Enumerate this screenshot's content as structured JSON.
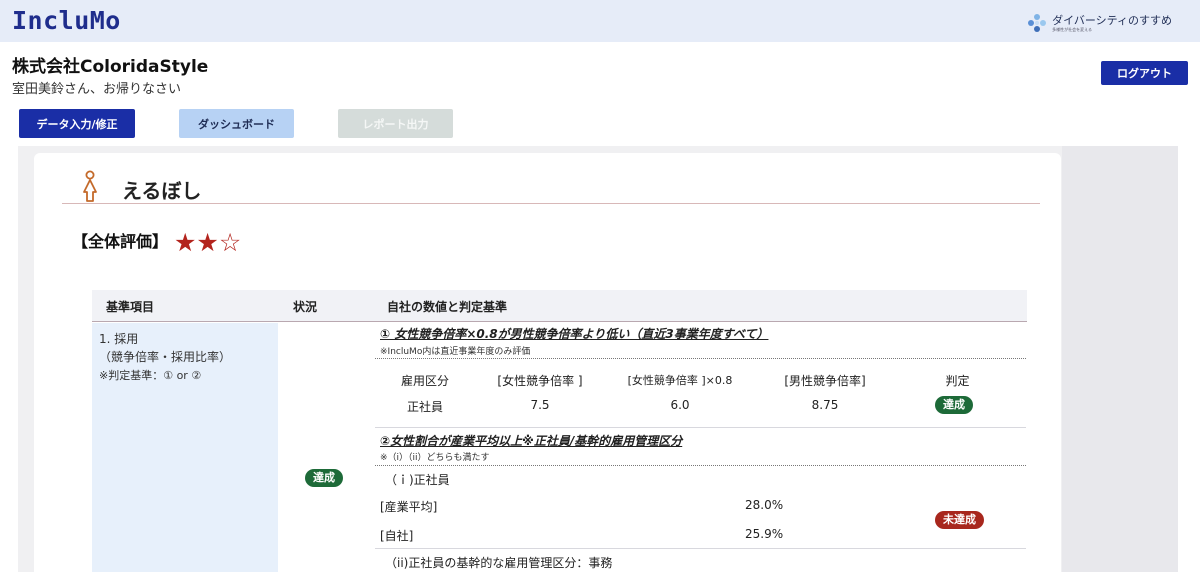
{
  "header": {
    "logo": "IncluMo",
    "diversity_main": "ダイバーシティのすすめ",
    "diversity_sub": "多様性が社会を変える",
    "company": "株式会社ColoridaStyle",
    "greeting": "室田美鈴さん、お帰りなさい",
    "logout_label": "ログアウト"
  },
  "nav": {
    "input_label": "データ入力/修正",
    "dashboard_label": "ダッシュボード",
    "report_label": "レポート出力"
  },
  "card": {
    "title": "えるぼし",
    "overall_label": "【全体評価】",
    "stars": "★★☆",
    "rating": 2,
    "rating_max": 3
  },
  "table": {
    "headers": [
      "基準項目",
      "状況",
      "自社の数値と判定基準"
    ],
    "category": {
      "line1": "1. 採用",
      "line2": "（競争倍率・採用比率）",
      "line3": "※判定基準：① or ②"
    },
    "status": "達成",
    "criterion1": {
      "title": "① 女性競争倍率×0.8が男性競争倍率より低い（直近3事業年度すべて）",
      "note": "※IncluMo内は直近事業年度のみ評価",
      "columns": [
        "雇用区分",
        "[女性競争倍率 ]",
        "[女性競争倍率 ]×0.8",
        "[男性競争倍率]",
        "判定"
      ],
      "row": [
        "正社員",
        "7.5",
        "6.0",
        "8.75"
      ],
      "judgement": "達成"
    },
    "criterion2": {
      "title": "②女性割合が産業平均以上※正社員/基幹的雇用管理区分",
      "note": "※（i）（ii）どちらも満たす",
      "sub_i": "（ｉ)正社員",
      "industry_label": "[産業平均]",
      "industry_value": "28.0%",
      "company_label": "[自社]",
      "company_value": "25.9%",
      "judgement": "未達成",
      "sub_ii": "（ii)正社員の基幹的な雇用管理区分：事務"
    }
  },
  "colors": {
    "brand": "#1f2d8c",
    "primary_button": "#1a2ea6",
    "achieved": "#1d6a38",
    "not_achieved": "#a8271d",
    "star": "#b3241d"
  }
}
